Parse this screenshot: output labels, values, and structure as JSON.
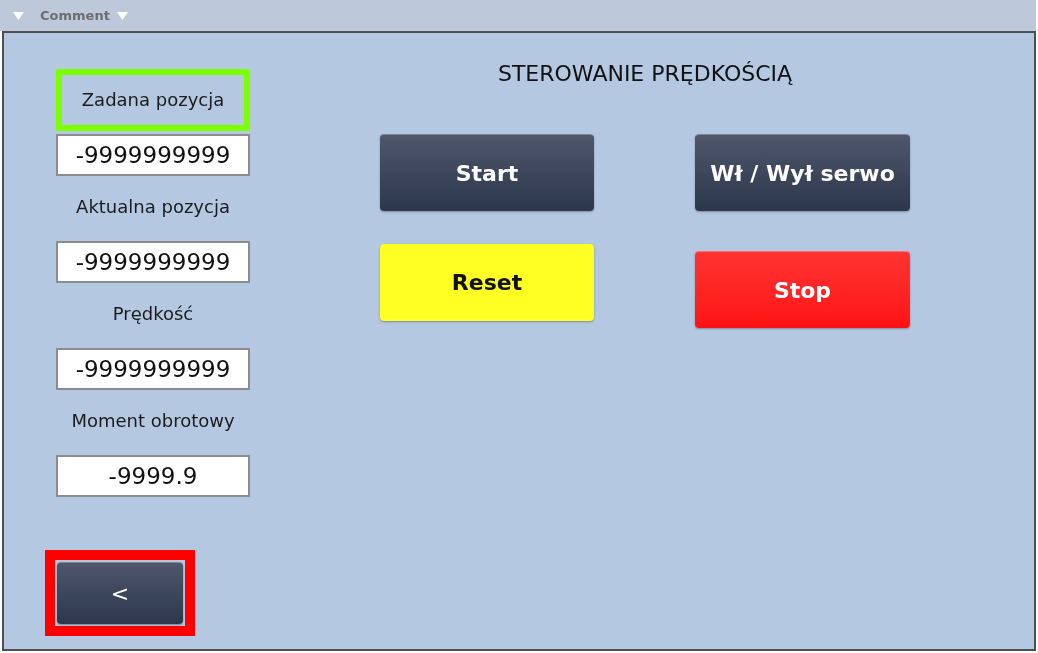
{
  "header": {
    "title": "Comment"
  },
  "fields": [
    {
      "label": "Zadana pozycja",
      "value": "-9999999999",
      "highlighted": true
    },
    {
      "label": "Aktualna pozycja",
      "value": "-9999999999",
      "highlighted": false
    },
    {
      "label": "Prędkość",
      "value": "-9999999999",
      "highlighted": false
    },
    {
      "label": "Moment obrotowy",
      "value": "-9999.9",
      "highlighted": false
    }
  ],
  "title": "STEROWANIE PRĘDKOŚCIĄ",
  "buttons": [
    {
      "label": "Start",
      "kind": "default"
    },
    {
      "label": "Wł / Wył serwo",
      "kind": "default"
    },
    {
      "label": "Reset",
      "kind": "warning"
    },
    {
      "label": "Stop",
      "kind": "danger"
    }
  ],
  "back_button": {
    "label": "<",
    "highlighted": true
  }
}
